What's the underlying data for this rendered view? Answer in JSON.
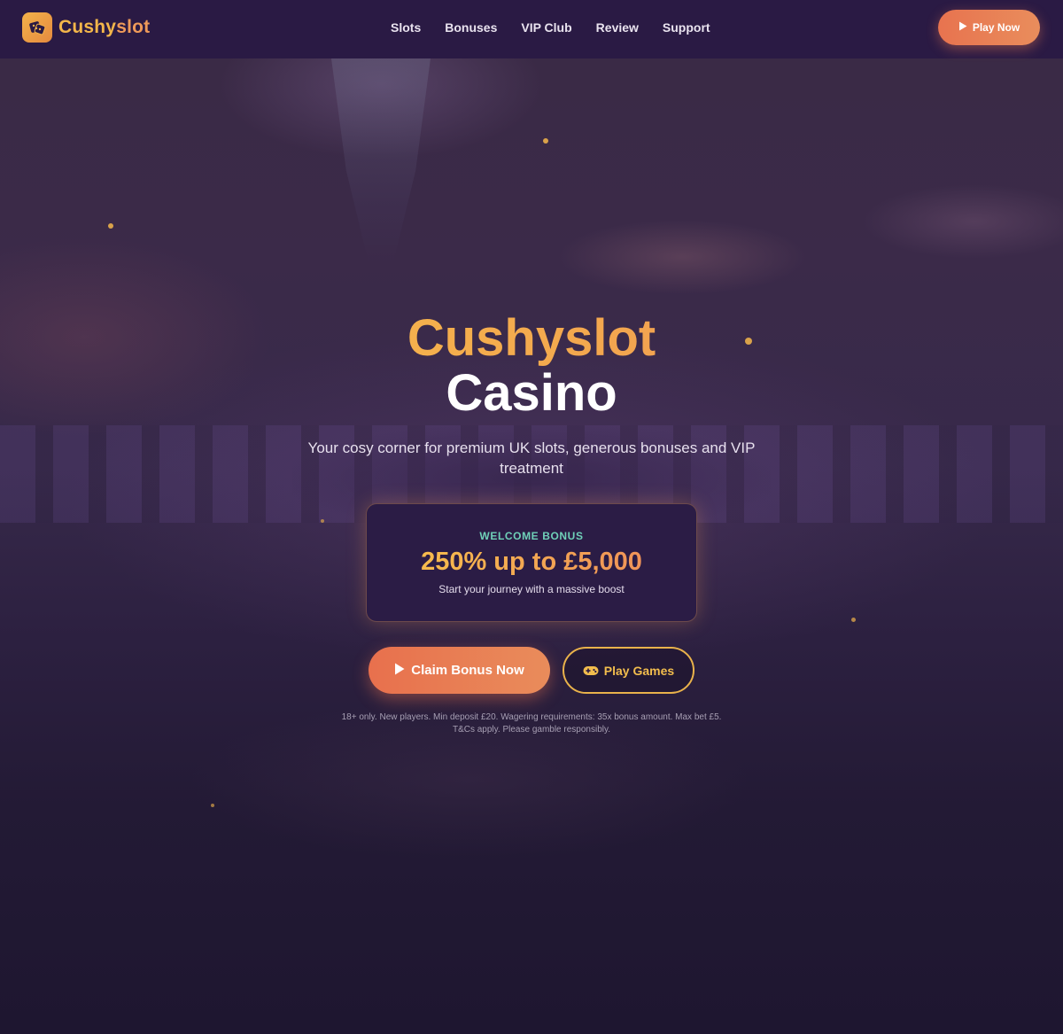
{
  "header": {
    "brand_part1": "Cushy",
    "brand_part2": "slot",
    "nav": [
      "Slots",
      "Bonuses",
      "VIP Club",
      "Review",
      "Support"
    ],
    "cta_label": "Play Now"
  },
  "hero": {
    "title_line1": "Cushyslot",
    "title_line2": "Casino",
    "subtitle": "Your cosy corner for premium UK slots, generous bonuses and VIP treatment",
    "bonus": {
      "label": "WELCOME BONUS",
      "amount": "250% up to £5,000",
      "description": "Start your journey with a massive boost"
    },
    "claim_label": "Claim Bonus Now",
    "games_label": "Play Games",
    "disclaimer": "18+ only. New players. Min deposit £20. Wagering requirements: 35x bonus amount. Max bet £5. T&Cs apply. Please gamble responsibly."
  },
  "icons": {
    "logo": "dice-icon",
    "play": "play-icon",
    "games": "gamepad-icon"
  },
  "colors": {
    "accent_gold": "#f3b64a",
    "accent_orange": "#e8734f",
    "teal_label": "#6fd0b8",
    "nav_bg": "#2a1a44"
  }
}
